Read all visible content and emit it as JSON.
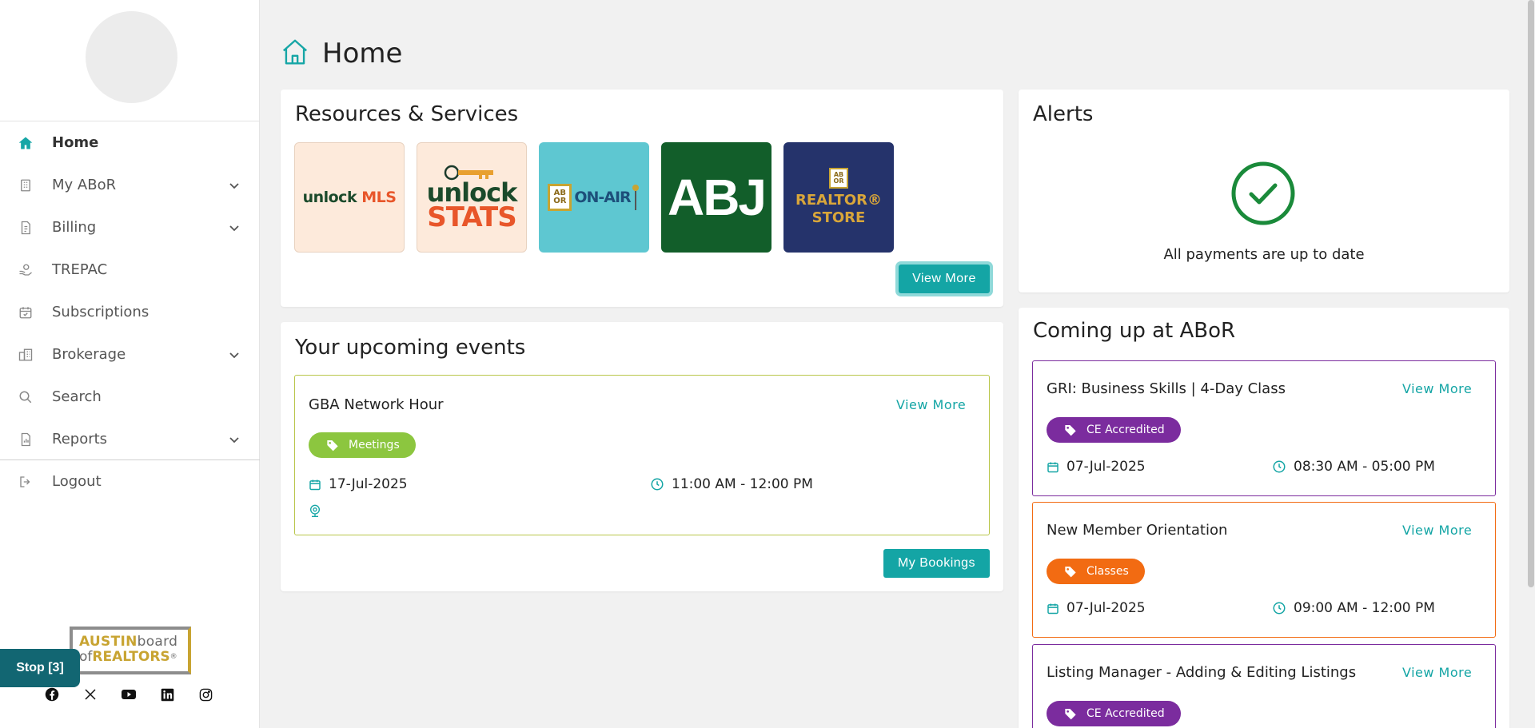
{
  "nav": {
    "items": [
      {
        "label": "Home",
        "icon": "home-icon",
        "expandable": false,
        "active": true
      },
      {
        "label": "My ABoR",
        "icon": "building-icon",
        "expandable": true
      },
      {
        "label": "Billing",
        "icon": "document-icon",
        "expandable": true
      },
      {
        "label": "TREPAC",
        "icon": "hand-coin-icon",
        "expandable": false
      },
      {
        "label": "Subscriptions",
        "icon": "calendar-check-icon",
        "expandable": false
      },
      {
        "label": "Brokerage",
        "icon": "office-building-icon",
        "expandable": true
      },
      {
        "label": "Search",
        "icon": "search-icon",
        "expandable": false
      },
      {
        "label": "Reports",
        "icon": "report-icon",
        "expandable": true
      }
    ],
    "logout": "Logout"
  },
  "logo": {
    "line1_a": "AUSTIN",
    "line1_b": "board",
    "line2_a": "of",
    "line2_b": "REALTORS",
    "reg": "®"
  },
  "stop_button": "Stop [3]",
  "page_title": "Home",
  "resources": {
    "title": "Resources & Services",
    "tiles": [
      {
        "name": "unlock-mls",
        "text_a": "unlock",
        "text_b": "MLS"
      },
      {
        "name": "unlock-stats",
        "text_a": "unlock",
        "text_b": "STATS"
      },
      {
        "name": "abor-on-air",
        "text_a": "AB OR",
        "text_b": "ON-AIR"
      },
      {
        "name": "abj",
        "text_a": "ABJ"
      },
      {
        "name": "realtor-store",
        "text_a": "REALTOR®",
        "text_b": "STORE",
        "badge": "AB OR"
      }
    ],
    "view_more": "View More"
  },
  "alerts": {
    "title": "Alerts",
    "message": "All payments are up to date"
  },
  "upcoming": {
    "title": "Your upcoming events",
    "event": {
      "title": "GBA Network Hour",
      "view_more": "View More",
      "tag": "Meetings",
      "date": "17-Jul-2025",
      "time": "11:00 AM - 12:00 PM"
    },
    "bookings_button": "My Bookings"
  },
  "coming_up": {
    "title": "Coming up at ABoR",
    "events": [
      {
        "title": "GRI: Business Skills | 4-Day Class",
        "view_more": "View More",
        "tag": "CE Accredited",
        "date": "07-Jul-2025",
        "time": "08:30 AM - 05:00 PM"
      },
      {
        "title": "New Member Orientation",
        "view_more": "View More",
        "tag": "Classes",
        "date": "07-Jul-2025",
        "time": "09:00 AM - 12:00 PM"
      },
      {
        "title": "Listing Manager - Adding & Editing Listings",
        "view_more": "View More",
        "tag": "CE Accredited"
      }
    ]
  },
  "colors": {
    "accent": "#14a5a5",
    "meetings": "#8cc63f",
    "ce_accredited": "#7b2c9e",
    "classes": "#f26b12",
    "success": "#1a8a3a"
  }
}
